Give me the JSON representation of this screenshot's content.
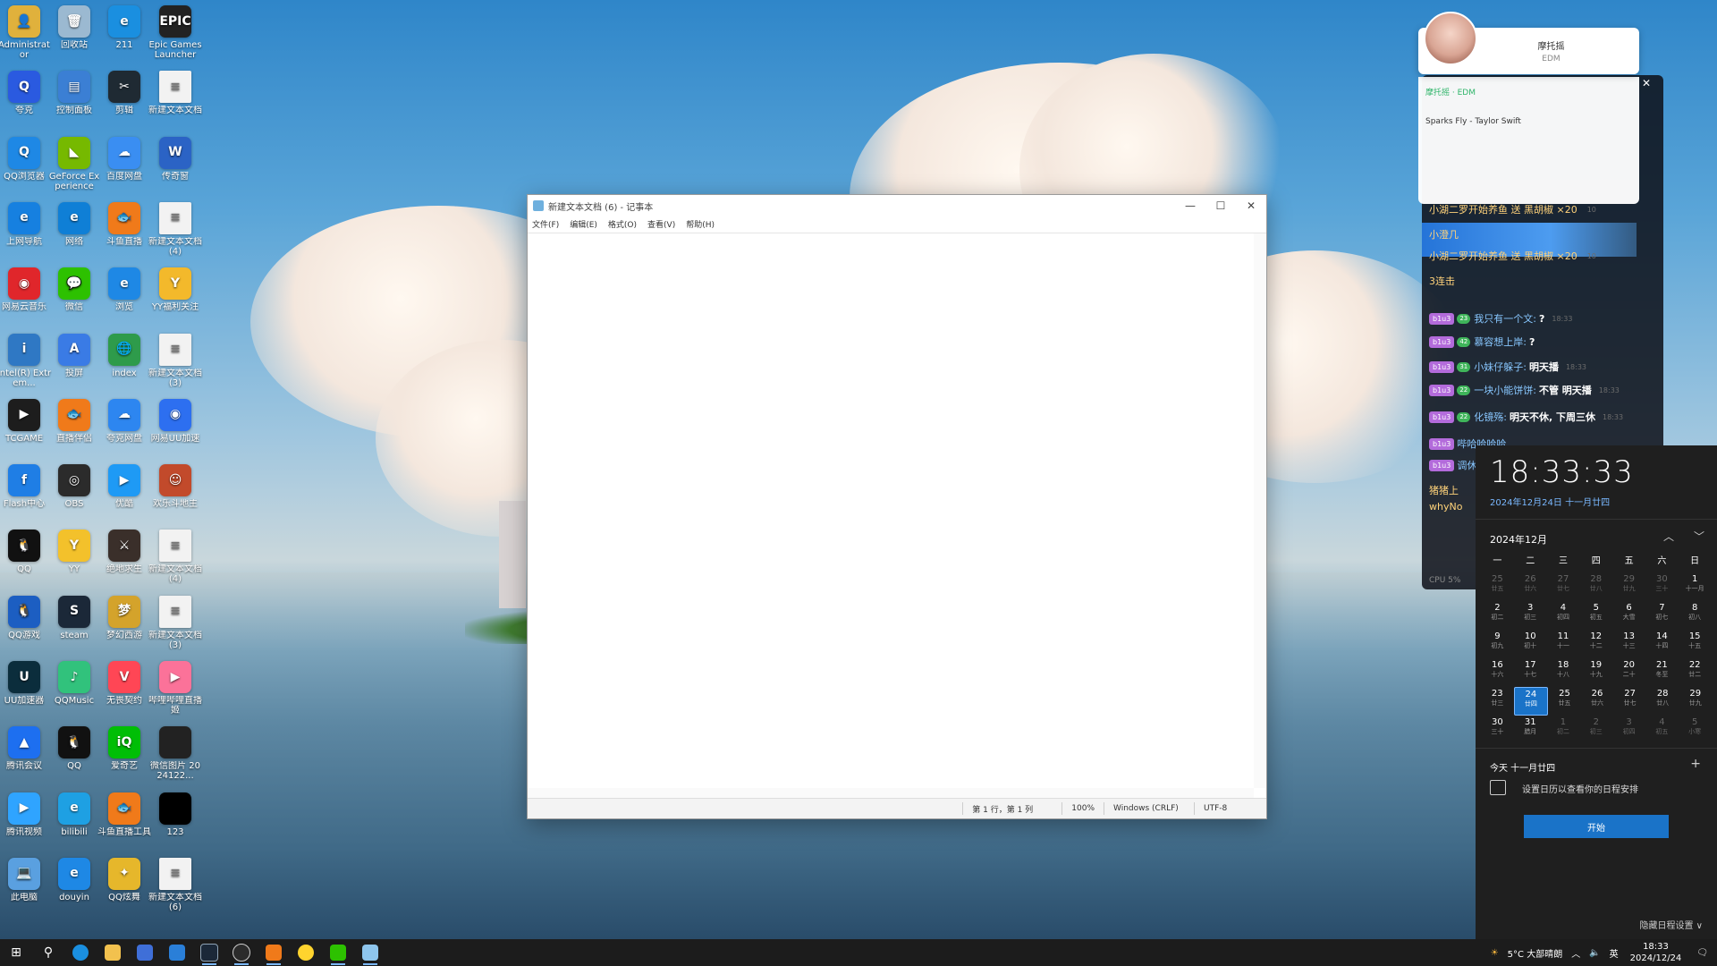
{
  "desktop_icons": [
    {
      "label": "Administrator",
      "color": "#e0b13c",
      "glyph": "👤"
    },
    {
      "label": "回收站",
      "color": "#9bb9d1",
      "glyph": "🗑"
    },
    {
      "label": "211",
      "color": "#1a8fe0",
      "glyph": "e"
    },
    {
      "label": "Epic Games Launcher",
      "color": "#222222",
      "glyph": "EPIC"
    },
    {
      "label": "夸克",
      "color": "#2a5ae0",
      "glyph": "Q"
    },
    {
      "label": "控制面板",
      "color": "#3b7fd4",
      "glyph": "▤"
    },
    {
      "label": "剪辑",
      "color": "#1f2a33",
      "glyph": "✂"
    },
    {
      "label": "新建文本文档",
      "color": "#f2f2f2",
      "glyph": "≡"
    },
    {
      "label": "QQ浏览器",
      "color": "#1e88e5",
      "glyph": "Q"
    },
    {
      "label": "GeForce Experience",
      "color": "#76b900",
      "glyph": "◣"
    },
    {
      "label": "百度网盘",
      "color": "#3a8ef2",
      "glyph": "☁"
    },
    {
      "label": "传奇窗",
      "color": "#2b63c5",
      "glyph": "W"
    },
    {
      "label": "上网导航",
      "color": "#1680e0",
      "glyph": "e"
    },
    {
      "label": "网络",
      "color": "#0f7fd6",
      "glyph": "e"
    },
    {
      "label": "斗鱼直播",
      "color": "#f07a1a",
      "glyph": "🐟"
    },
    {
      "label": "新建文本文档 (4)",
      "color": "#f2f2f2",
      "glyph": "≡"
    },
    {
      "label": "网易云音乐",
      "color": "#e0262b",
      "glyph": "◉"
    },
    {
      "label": "微信",
      "color": "#2dc100",
      "glyph": "💬"
    },
    {
      "label": "浏览",
      "color": "#1e88e5",
      "glyph": "e"
    },
    {
      "label": "YY福利关注",
      "color": "#f3b92b",
      "glyph": "Y"
    },
    {
      "label": "Intel(R) Extrem...",
      "color": "#2f78c4",
      "glyph": "i"
    },
    {
      "label": "投屏",
      "color": "#3a7be5",
      "glyph": "A"
    },
    {
      "label": "index",
      "color": "#2e9b4b",
      "glyph": "🌐"
    },
    {
      "label": "新建文本文档 (3)",
      "color": "#f2f2f2",
      "glyph": "≡"
    },
    {
      "label": "TCGAME",
      "color": "#1d1d1d",
      "glyph": "▶"
    },
    {
      "label": "直播伴侣",
      "color": "#f07a1a",
      "glyph": "🐟"
    },
    {
      "label": "夸克网盘",
      "color": "#2d86f0",
      "glyph": "☁"
    },
    {
      "label": "网易UU加速",
      "color": "#2d6ff0",
      "glyph": "◉"
    },
    {
      "label": "Flash中心",
      "color": "#1f7ee5",
      "glyph": "f"
    },
    {
      "label": "OBS",
      "color": "#2b2b2b",
      "glyph": "◎"
    },
    {
      "label": "优酷",
      "color": "#1e9af5",
      "glyph": "▶"
    },
    {
      "label": "欢乐斗地主",
      "color": "#c24a2b",
      "glyph": "☺"
    },
    {
      "label": "QQ",
      "color": "#111111",
      "glyph": "🐧"
    },
    {
      "label": "YY",
      "color": "#f3c12b",
      "glyph": "Y"
    },
    {
      "label": "绝地求生",
      "color": "#3a2f2a",
      "glyph": "⚔"
    },
    {
      "label": "新建文本文档 (4)",
      "color": "#f2f2f2",
      "glyph": "≡"
    },
    {
      "label": "QQ游戏",
      "color": "#1c5ec2",
      "glyph": "🐧"
    },
    {
      "label": "steam",
      "color": "#1b2838",
      "glyph": "S"
    },
    {
      "label": "梦幻西游",
      "color": "#d4a32b",
      "glyph": "梦"
    },
    {
      "label": "新建文本文档 (3)",
      "color": "#f2f2f2",
      "glyph": "≡"
    },
    {
      "label": "UU加速器",
      "color": "#0b2d3c",
      "glyph": "U"
    },
    {
      "label": "QQMusic",
      "color": "#31c27c",
      "glyph": "♪"
    },
    {
      "label": "无畏契约",
      "color": "#ff4655",
      "glyph": "V"
    },
    {
      "label": "哔哩哔哩直播姬",
      "color": "#fb7299",
      "glyph": "▶"
    },
    {
      "label": "腾讯会议",
      "color": "#1d6ff0",
      "glyph": "▲"
    },
    {
      "label": "QQ",
      "color": "#111111",
      "glyph": "🐧"
    },
    {
      "label": "爱奇艺",
      "color": "#00be06",
      "glyph": "iQ"
    },
    {
      "label": "微信图片 2024122...",
      "color": "#222222",
      "glyph": " "
    },
    {
      "label": "腾讯视频",
      "color": "#2fa4ff",
      "glyph": "▶"
    },
    {
      "label": "bilibili",
      "color": "#1ea0e3",
      "glyph": "e"
    },
    {
      "label": "斗鱼直播工具",
      "color": "#f07a1a",
      "glyph": "🐟"
    },
    {
      "label": "123",
      "color": "#000000",
      "glyph": " "
    },
    {
      "label": "此电脑",
      "color": "#5aa0e0",
      "glyph": "💻"
    },
    {
      "label": "douyin",
      "color": "#1e88e5",
      "glyph": "e"
    },
    {
      "label": "QQ炫舞",
      "color": "#e6b72b",
      "glyph": "✦"
    },
    {
      "label": "新建文本文档 (6)",
      "color": "#f2f2f2",
      "glyph": "≡"
    }
  ],
  "notepad": {
    "title": "新建文本文档 (6) - 记事本",
    "menu": [
      "文件(F)",
      "编辑(E)",
      "格式(O)",
      "查看(V)",
      "帮助(H)"
    ],
    "status": {
      "position": "第 1 行，第 1 列",
      "zoom": "100%",
      "line_ending": "Windows (CRLF)",
      "encoding": "UTF-8"
    }
  },
  "music": {
    "artist": "摩托摇",
    "genre": "EDM",
    "tag": "摩托摇 · EDM",
    "song": "Sparks Fly - Taylor Swift"
  },
  "chat": {
    "lines": [
      {
        "badge": "",
        "lvl": "",
        "nick": "小湖二罗开始养鱼 送 黑胡椒 ×20",
        "msg": "",
        "time": "10"
      },
      {
        "badge": "",
        "lvl": "",
        "nick": "小澄几",
        "msg": "",
        "time": ""
      },
      {
        "badge": "",
        "lvl": "",
        "nick": "小湖二罗开始养鱼 送 黑胡椒 ×20",
        "msg": "",
        "time": "10"
      },
      {
        "badge": "",
        "lvl": "",
        "nick": "3连击",
        "msg": "",
        "time": ""
      },
      {
        "badge": "b1u3",
        "lvl": "23",
        "nick": "我只有一个文:",
        "msg": "?",
        "time": "18:33"
      },
      {
        "badge": "b1u3",
        "lvl": "42",
        "nick": "慕容想上岸:",
        "msg": "?",
        "time": ""
      },
      {
        "badge": "b1u3",
        "lvl": "31",
        "nick": "小妹仔躲子:",
        "msg": "明天播",
        "time": "18:33"
      },
      {
        "badge": "b1u3",
        "lvl": "22",
        "nick": "一块小能饼饼:",
        "msg": "不管 明天播",
        "time": "18:33"
      },
      {
        "badge": "b1u3",
        "lvl": "22",
        "nick": "化镜殇:",
        "msg": "明天不休, 下周三休",
        "time": "18:33"
      },
      {
        "badge": "b1u3",
        "lvl": "",
        "nick": "哔哈哈哈哈",
        "msg": "",
        "time": ""
      },
      {
        "badge": "b1u3",
        "lvl": "",
        "nick": "调休了,",
        "msg": "",
        "time": ""
      },
      {
        "badge": "",
        "lvl": "",
        "nick": "猪猪上",
        "msg": "",
        "time": ""
      },
      {
        "badge": "",
        "lvl": "",
        "nick": "whyNo",
        "msg": "",
        "time": ""
      }
    ],
    "cpu": "CPU 5%"
  },
  "calendar": {
    "clock": "18:33:33",
    "date": "2024年12月24日 十一月廿四",
    "month": "2024年12月",
    "weekdays": [
      "一",
      "二",
      "三",
      "四",
      "五",
      "六",
      "日"
    ],
    "weeks": [
      [
        {
          "d": "25",
          "l": "廿五",
          "dim": true
        },
        {
          "d": "26",
          "l": "廿六",
          "dim": true
        },
        {
          "d": "27",
          "l": "廿七",
          "dim": true
        },
        {
          "d": "28",
          "l": "廿八",
          "dim": true
        },
        {
          "d": "29",
          "l": "廿九",
          "dim": true
        },
        {
          "d": "30",
          "l": "三十",
          "dim": true
        },
        {
          "d": "1",
          "l": "十一月"
        }
      ],
      [
        {
          "d": "2",
          "l": "初二"
        },
        {
          "d": "3",
          "l": "初三"
        },
        {
          "d": "4",
          "l": "初四"
        },
        {
          "d": "5",
          "l": "初五"
        },
        {
          "d": "6",
          "l": "大雪"
        },
        {
          "d": "7",
          "l": "初七"
        },
        {
          "d": "8",
          "l": "初八"
        }
      ],
      [
        {
          "d": "9",
          "l": "初九"
        },
        {
          "d": "10",
          "l": "初十"
        },
        {
          "d": "11",
          "l": "十一"
        },
        {
          "d": "12",
          "l": "十二"
        },
        {
          "d": "13",
          "l": "十三"
        },
        {
          "d": "14",
          "l": "十四"
        },
        {
          "d": "15",
          "l": "十五"
        }
      ],
      [
        {
          "d": "16",
          "l": "十六"
        },
        {
          "d": "17",
          "l": "十七"
        },
        {
          "d": "18",
          "l": "十八"
        },
        {
          "d": "19",
          "l": "十九"
        },
        {
          "d": "20",
          "l": "二十"
        },
        {
          "d": "21",
          "l": "冬至"
        },
        {
          "d": "22",
          "l": "廿二"
        }
      ],
      [
        {
          "d": "23",
          "l": "廿三"
        },
        {
          "d": "24",
          "l": "廿四",
          "today": true
        },
        {
          "d": "25",
          "l": "廿五"
        },
        {
          "d": "26",
          "l": "廿六"
        },
        {
          "d": "27",
          "l": "廿七"
        },
        {
          "d": "28",
          "l": "廿八"
        },
        {
          "d": "29",
          "l": "廿九"
        }
      ],
      [
        {
          "d": "30",
          "l": "三十"
        },
        {
          "d": "31",
          "l": "腊月"
        },
        {
          "d": "1",
          "l": "初二",
          "dim": true
        },
        {
          "d": "2",
          "l": "初三",
          "dim": true
        },
        {
          "d": "3",
          "l": "初四",
          "dim": true
        },
        {
          "d": "4",
          "l": "初五",
          "dim": true
        },
        {
          "d": "5",
          "l": "小寒",
          "dim": true
        }
      ]
    ],
    "today_label": "今天 十一月廿四",
    "hint": "设置日历以查看你的日程安排",
    "start": "开始",
    "hide": "隐藏日程设置 ∨"
  },
  "taskbar": {
    "weather": "5°C 大部晴朗",
    "lang": "英",
    "time": "18:33",
    "date": "2024/12/24"
  }
}
